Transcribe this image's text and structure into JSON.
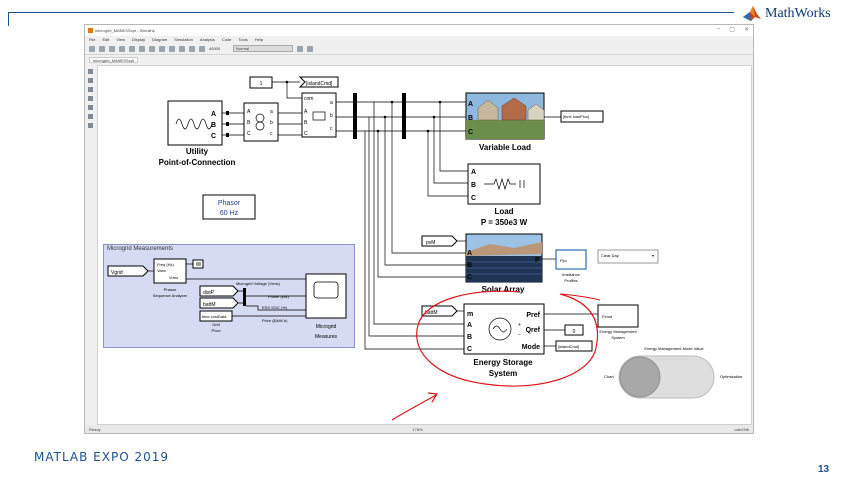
{
  "slide": {
    "brand": "MathWorks",
    "footer": "MATLAB EXPO 2019",
    "page_number": "13"
  },
  "window": {
    "title": "microgrid_MANESScpt - Simulink",
    "controls": [
      "–",
      "▢",
      "✕"
    ],
    "menu": [
      "File",
      "Edit",
      "View",
      "Display",
      "Diagram",
      "Simulation",
      "Analysis",
      "Code",
      "Tools",
      "Help"
    ],
    "stop_time": "40000",
    "sim_mode": "Normal",
    "tab": "microgrid_MANESScpt",
    "status_left": "Ready",
    "status_center": "178%",
    "status_right": "ode23tb"
  },
  "diagram": {
    "const_value": "1",
    "island_cmd_tag": "[islandCmd]",
    "com_label": "com",
    "utility_title": "Utility",
    "utility_subtitle": "Point-of-Connection",
    "phasor_line1": "Phasor",
    "phasor_line2": "60 Hz",
    "variable_load": "Variable Load",
    "time_load_from": "[time loadFlux]",
    "load_title": "Load",
    "load_power": "P = 350e3 W",
    "pvm_goto": "pvM",
    "solar_array": "Solar Array",
    "irradiance_ppv": "Ppv",
    "irradiance_label1": "Irradiance",
    "irradiance_label2": "Profiles",
    "irradiance_select": "Clear Day",
    "battm_goto": "battM",
    "ess_title1": "Energy Storage",
    "ess_title2": "System",
    "ess_ports": [
      "Pref",
      "Qref",
      "Mode"
    ],
    "ess_input_ports": [
      "m",
      "A",
      "B",
      "C"
    ],
    "qref_value": "0",
    "island_cmd_from": "[islandCmd]",
    "pcmd": "Pcmd",
    "ems_label1": "Energy Management",
    "ems_label2": "System",
    "ems_switch_title": "Energy Management Mode Value",
    "ems_switch_left": "Chart",
    "ems_switch_right": "Optimization"
  },
  "measurements": {
    "panel_title": "Microgrid Measurements",
    "vgrid": "Vgrid",
    "freq_label": "Freq (Hz)",
    "vabc_label": "Vabc",
    "vrms_label": "Vrms",
    "phasor_analyzer1": "Phasor",
    "phasor_analyzer2": "Sequence Analyzer",
    "distp": "distP",
    "battm": "battM",
    "time_cost": "time costData",
    "grid_price1": "Grid",
    "grid_price2": "Price",
    "signal_voltage": "Microgrid Voltage (Vrms)",
    "signal_power": "Power (kW)",
    "signal_soc": "ESS SOC (%)",
    "signal_price": "Price ($/kW-h)",
    "measures1": "Microgrid",
    "measures2": "Measures"
  },
  "annotation": {
    "color": "#e1141c"
  },
  "colors": {
    "brand_blue": "#1d4f91",
    "panel_fill": "#d6daf2",
    "phasor_text": "#1f3d8a"
  }
}
